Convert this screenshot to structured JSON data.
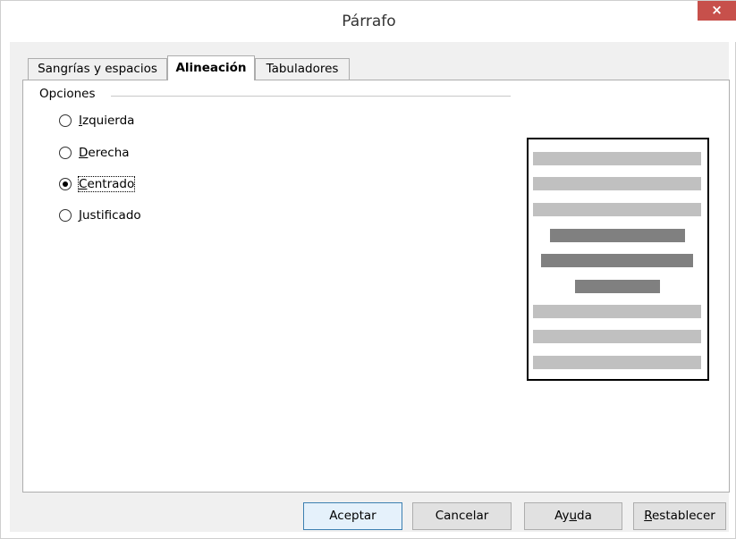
{
  "window": {
    "title": "Párrafo",
    "close_glyph": "×"
  },
  "tabs": [
    {
      "label": "Sangrías y espacios",
      "active": false
    },
    {
      "label": "Alineación",
      "active": true
    },
    {
      "label": "Tabuladores",
      "active": false
    }
  ],
  "options": {
    "group_label": "Opciones",
    "radios": [
      {
        "label": "Izquierda",
        "mnemonic": "I",
        "rest": "zquierda",
        "checked": false
      },
      {
        "label": "Derecha",
        "mnemonic": "D",
        "rest": "erecha",
        "checked": false
      },
      {
        "label": "Centrado",
        "mnemonic": "C",
        "rest": "entrado",
        "checked": true
      },
      {
        "label": "Justificado",
        "mnemonic": "J",
        "rest": "ustificado",
        "checked": false
      }
    ]
  },
  "preview": {
    "light_color": "#c0c0c0",
    "dark_color": "#808080",
    "lines": [
      "light",
      "light",
      "light",
      "dark",
      "dark",
      "dark",
      "light",
      "light",
      "light"
    ]
  },
  "buttons": {
    "ok": "Aceptar",
    "cancel": "Cancelar",
    "help_pre": "Ay",
    "help_mn": "u",
    "help_post": "da",
    "reset_mn": "R",
    "reset_post": "establecer"
  },
  "colors": {
    "close_bg": "#c7504b",
    "dialog_bg": "#f0f0f0",
    "default_button_border": "#3c7fb1"
  }
}
